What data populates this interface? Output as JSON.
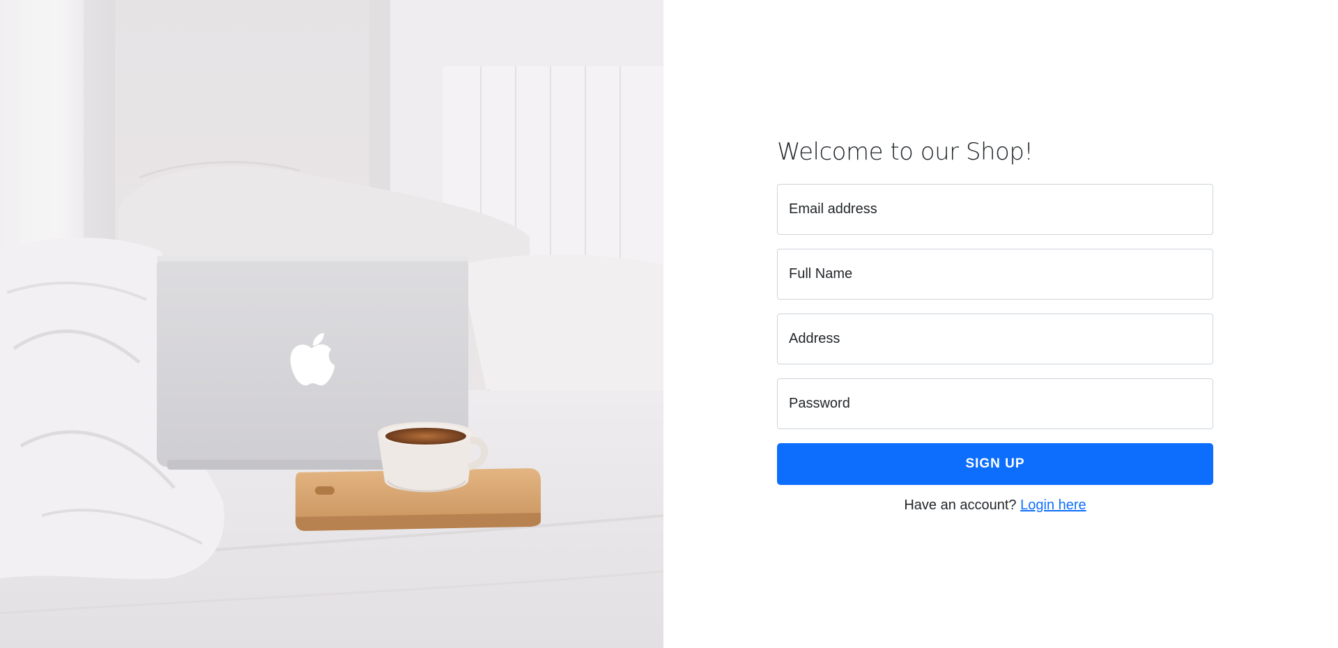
{
  "hero": {
    "logo_icon": "apple-logo-icon"
  },
  "form": {
    "title": "Welcome to our Shop!",
    "email_placeholder": "Email address",
    "fullname_placeholder": "Full Name",
    "address_placeholder": "Address",
    "password_placeholder": "Password",
    "submit_label": "SIGN UP",
    "account_prompt": "Have an account?",
    "login_link": "Login here"
  },
  "colors": {
    "primary": "#0d6efd",
    "text": "#212529",
    "border": "#ced4da"
  }
}
